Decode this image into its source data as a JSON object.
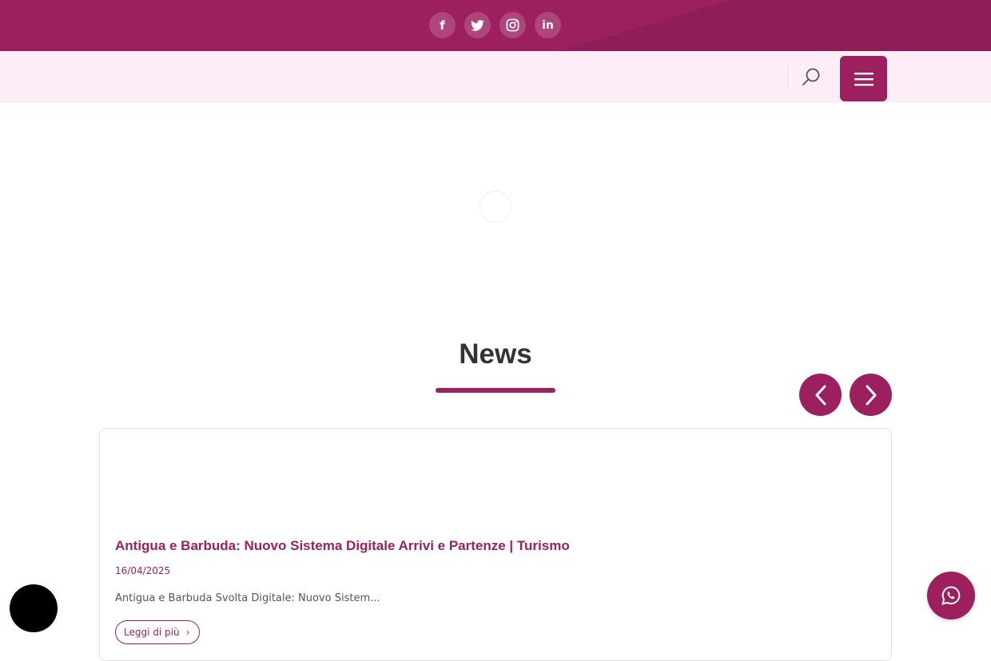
{
  "social": {
    "items": [
      {
        "name": "facebook",
        "glyph": "f"
      },
      {
        "name": "twitter",
        "glyph": ""
      },
      {
        "name": "instagram",
        "glyph": ""
      },
      {
        "name": "linkedin",
        "glyph": "in"
      }
    ]
  },
  "news": {
    "title": "News",
    "card": {
      "title": "Antigua e Barbuda: Nuovo Sistema Digitale Arrivi e Partenze | Turismo",
      "date": "16/04/2025",
      "excerpt": "Antigua e Barbuda Svolta Digitale: Nuovo Sistem...",
      "read_more": "Leggi di più",
      "read_more_icon": "›"
    }
  },
  "colors": {
    "brand": "#9c1f5e",
    "brand_dark": "#8f1d58",
    "nav_bg": "#fcedf7",
    "heading": "#333333"
  },
  "icons": {
    "search": "search-icon",
    "menu": "hamburger-menu-icon",
    "prev": "chevron-left-icon",
    "next": "chevron-right-icon",
    "whatsapp": "whatsapp-icon",
    "accessibility": "accessibility-icon"
  }
}
